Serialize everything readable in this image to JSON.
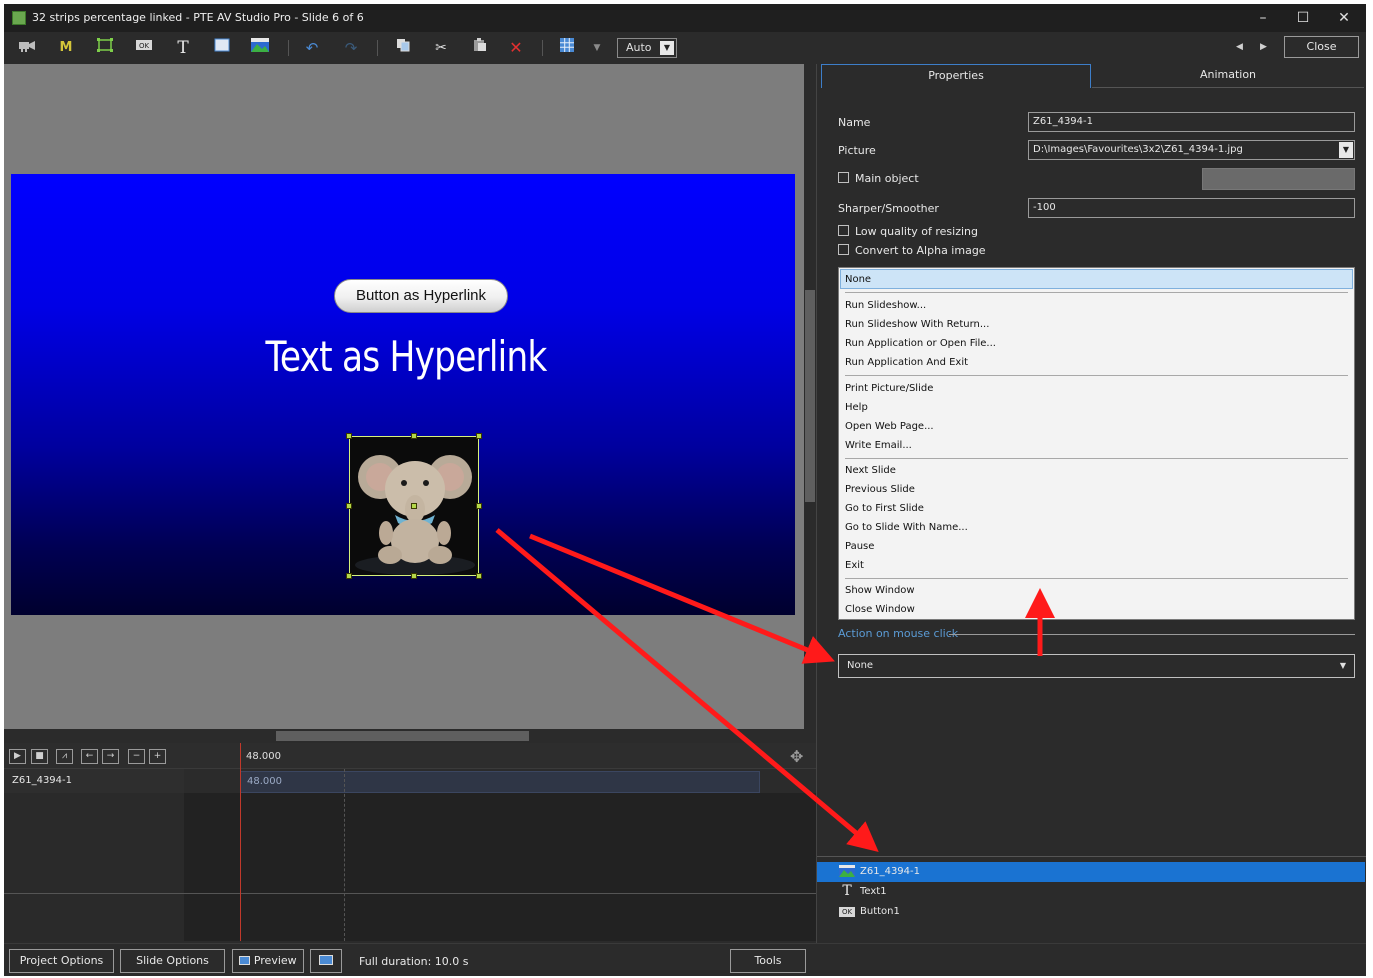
{
  "window": {
    "title": "32 strips percentage linked - PTE AV Studio Pro - Slide 6 of 6"
  },
  "window_controls": {
    "minimize": "–",
    "maximize": "☐",
    "close": "✕"
  },
  "toolbar": {
    "icons": [
      "camera-icon",
      "mask-icon",
      "frame-icon",
      "button-object-icon",
      "text-icon",
      "rectangle-icon",
      "image-icon",
      "undo-icon",
      "redo-icon",
      "copy-icon",
      "cut-icon",
      "paste-icon",
      "delete-icon",
      "grid-icon",
      "grid-dropdown-icon"
    ],
    "mask_glyph": "M",
    "text_glyph": "T",
    "zoom_value": "Auto",
    "close_label": "Close"
  },
  "slide": {
    "button_text": "Button as Hyperlink",
    "text_object": "Text as Hyperlink",
    "background_colors": [
      "#0000ff",
      "#00002e"
    ]
  },
  "timeline": {
    "buttons": [
      "▶",
      "■",
      "⩘",
      "←",
      "→",
      "−",
      "+"
    ],
    "ruler_time": "48.000",
    "track_label": "Z61_4394-1",
    "track_time": "48.000"
  },
  "bottom": {
    "project_options": "Project Options",
    "slide_options": "Slide Options",
    "preview": "Preview",
    "full_duration": "Full duration: 10.0 s",
    "tools": "Tools"
  },
  "properties": {
    "tabs": [
      "Properties",
      "Animation"
    ],
    "name_label": "Name",
    "name_value": "Z61_4394-1",
    "picture_label": "Picture",
    "picture_value": "D:\\Images\\Favourites\\3x2\\Z61_4394-1.jpg",
    "main_object_label": "Main object",
    "sharper_label": "Sharper/Smoother",
    "sharper_value": "-100",
    "low_quality_label": "Low quality of resizing",
    "alpha_label": "Convert to Alpha image",
    "action_dropdown": {
      "selected": "None",
      "groups": [
        [
          "Run Slideshow...",
          "Run Slideshow With Return...",
          "Run Application or Open File...",
          "Run Application And Exit"
        ],
        [
          "Print Picture/Slide",
          "Help",
          "Open Web Page...",
          "Write Email..."
        ],
        [
          "Next Slide",
          "Previous Slide",
          "Go to First Slide",
          "Go to Slide With Name...",
          "Pause",
          "Exit"
        ],
        [
          "Show Window",
          "Close Window"
        ]
      ]
    },
    "action_section_label": "Action on mouse click",
    "action_value": "None"
  },
  "objects": [
    {
      "name": "Z61_4394-1",
      "icon": "image-icon",
      "selected": true
    },
    {
      "name": "Text1",
      "icon": "text-icon",
      "glyph": "T",
      "selected": false
    },
    {
      "name": "Button1",
      "icon": "button-object-icon",
      "glyph": "OK",
      "selected": false
    }
  ],
  "colors": {
    "accent": "#1a73d2",
    "annotation_arrow": "#ff1a1a",
    "selection_handles": "#b4d84a"
  }
}
